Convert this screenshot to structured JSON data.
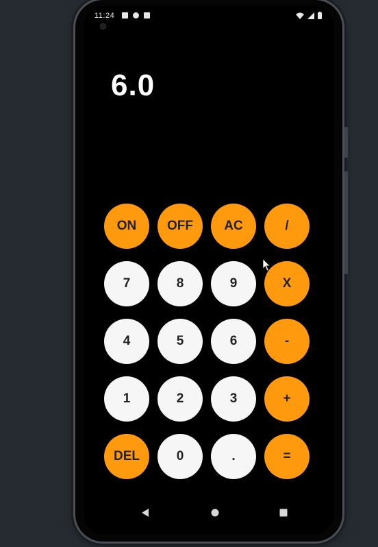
{
  "status_bar": {
    "time": "11:24",
    "left_icons": [
      "notification-icon",
      "sync-icon",
      "sd-card-icon"
    ],
    "right_icons": [
      "wifi-icon",
      "signal-icon",
      "battery-icon"
    ]
  },
  "display": {
    "value": "6.0"
  },
  "keys": [
    {
      "id": "on",
      "label": "ON",
      "color": "orange"
    },
    {
      "id": "off",
      "label": "OFF",
      "color": "orange"
    },
    {
      "id": "ac",
      "label": "AC",
      "color": "orange"
    },
    {
      "id": "divide",
      "label": "/",
      "color": "orange"
    },
    {
      "id": "7",
      "label": "7",
      "color": "white"
    },
    {
      "id": "8",
      "label": "8",
      "color": "white"
    },
    {
      "id": "9",
      "label": "9",
      "color": "white"
    },
    {
      "id": "multiply",
      "label": "X",
      "color": "orange"
    },
    {
      "id": "4",
      "label": "4",
      "color": "white"
    },
    {
      "id": "5",
      "label": "5",
      "color": "white"
    },
    {
      "id": "6",
      "label": "6",
      "color": "white"
    },
    {
      "id": "minus",
      "label": "-",
      "color": "orange"
    },
    {
      "id": "1",
      "label": "1",
      "color": "white"
    },
    {
      "id": "2",
      "label": "2",
      "color": "white"
    },
    {
      "id": "3",
      "label": "3",
      "color": "white"
    },
    {
      "id": "plus",
      "label": "+",
      "color": "orange"
    },
    {
      "id": "del",
      "label": "DEL",
      "color": "orange"
    },
    {
      "id": "0",
      "label": "0",
      "color": "white"
    },
    {
      "id": "dot",
      "label": ".",
      "color": "white"
    },
    {
      "id": "equals",
      "label": "=",
      "color": "orange"
    }
  ],
  "nav_bar": {
    "buttons": [
      "back-icon",
      "home-icon",
      "recents-icon"
    ]
  },
  "colors": {
    "accent": "#ff9a0f",
    "key_light": "#f6f6f6",
    "screen_bg": "#000000",
    "desktop_bg": "#262b31"
  }
}
